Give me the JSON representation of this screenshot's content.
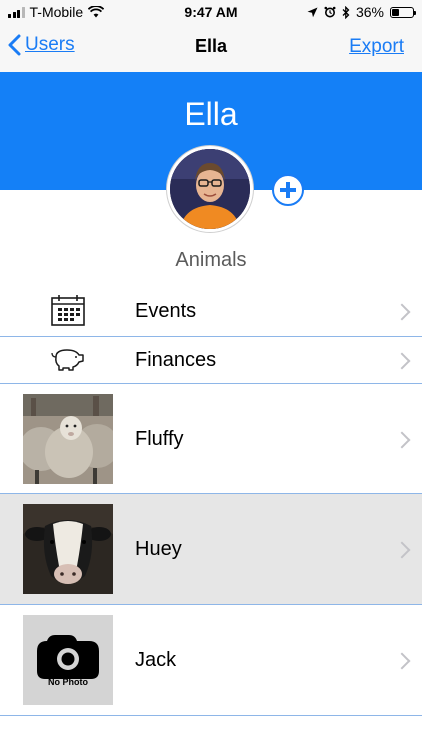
{
  "status_bar": {
    "carrier": "T-Mobile",
    "time": "9:47 AM",
    "battery": "36%",
    "battery_level": 0.36
  },
  "nav": {
    "back_label": "Users",
    "title": "Ella",
    "export_label": "Export"
  },
  "header": {
    "name": "Ella"
  },
  "section_label": "Animals",
  "menu": {
    "events": "Events",
    "finances": "Finances"
  },
  "animals": [
    {
      "name": "Fluffy"
    },
    {
      "name": "Huey"
    },
    {
      "name": "Jack"
    }
  ],
  "no_photo_label": "No Photo",
  "colors": {
    "accent": "#1a7cf5",
    "header_bg": "#1480f7",
    "selected_row": "#e6e6e6",
    "divider": "#8eb6e8"
  }
}
